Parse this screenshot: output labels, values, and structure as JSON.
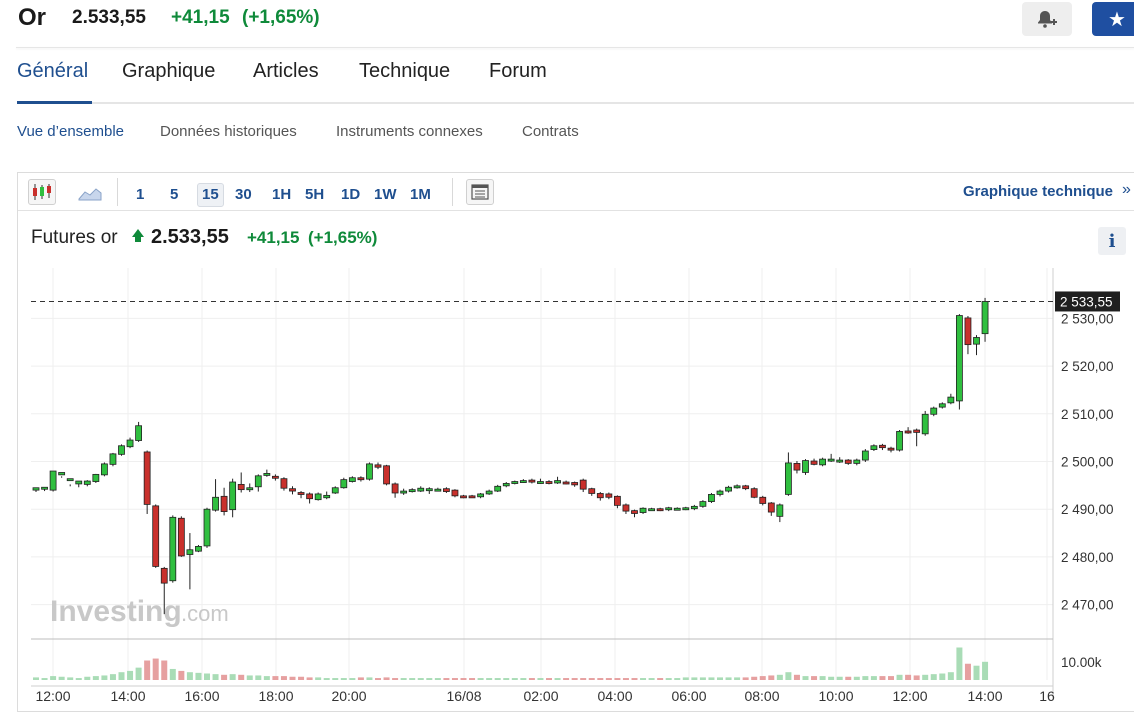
{
  "header": {
    "name": "Or",
    "price": "2.533,55",
    "change": "+41,15",
    "change_pct": "(+1,65%)",
    "star_icon": "★"
  },
  "tabs": [
    {
      "label": "Général"
    },
    {
      "label": "Graphique"
    },
    {
      "label": "Articles"
    },
    {
      "label": "Technique"
    },
    {
      "label": "Forum"
    }
  ],
  "subtabs": [
    {
      "label": "Vue d’ensemble"
    },
    {
      "label": "Données historiques"
    },
    {
      "label": "Instruments connexes"
    },
    {
      "label": "Contrats"
    }
  ],
  "toolbar": {
    "timeframes": [
      "1",
      "5",
      "15",
      "30",
      "1H",
      "5H",
      "1D",
      "1W",
      "1M"
    ],
    "selected_timeframe": "15",
    "tech_link": "Graphique technique",
    "tech_link_arrow": "»",
    "icons": [
      "candlestick-icon",
      "area-chart-icon",
      "layout-icon"
    ]
  },
  "futures": {
    "name": "Futures or",
    "price": "2.533,55",
    "change": "+41,15",
    "change_pct": "(+1,65%)",
    "info_label": "i"
  },
  "watermark": {
    "brand": "Investing",
    "suffix": ".com"
  },
  "colors": {
    "accent": "#1f4f8f",
    "up": "#2fbf3f",
    "down": "#c9302c",
    "positive_text": "#0f8a3a",
    "fav_button": "#1f4fa1"
  },
  "chart_data": {
    "type": "candlestick",
    "price_axis_ticks": [
      "2 530,00",
      "2 520,00",
      "2 510,00",
      "2 500,00",
      "2 490,00",
      "2 480,00",
      "2 470,00"
    ],
    "price_axis_values": [
      2530,
      2520,
      2510,
      2500,
      2490,
      2480,
      2470
    ],
    "last_price_label": "2 533,55",
    "last_price": 2533.55,
    "volume_axis_label": "10.00k",
    "x_tick_labels": [
      "12:00",
      "14:00",
      "16:00",
      "18:00",
      "20:00",
      "16/08",
      "02:00",
      "04:00",
      "06:00",
      "08:00",
      "10:00",
      "12:00",
      "14:00",
      "16"
    ],
    "ylim": [
      2464,
      2537
    ],
    "grid": true,
    "candles": [
      [
        2494,
        2494.5,
        2494,
        2493.6
      ],
      [
        2494.3,
        2494.6,
        2494.3,
        2493.8
      ],
      [
        2494,
        2498,
        2497.3,
        2493.7
      ],
      [
        2497.2,
        2497.7,
        2496.9,
        2496.6
      ],
      [
        2496.3,
        2496.4,
        2495.2,
        2494.8
      ],
      [
        2495.3,
        2495.9,
        2495.4,
        2494.6
      ],
      [
        2495.2,
        2495.9,
        2496.1,
        2494.8
      ],
      [
        2495.8,
        2497.3,
        2497.4,
        2495.5
      ],
      [
        2497.2,
        2499.5,
        2499.8,
        2496.9
      ],
      [
        2499.4,
        2501.6,
        2501.8,
        2499
      ],
      [
        2501.5,
        2503.3,
        2503.6,
        2501.2
      ],
      [
        2503.1,
        2504.5,
        2505,
        2502.8
      ],
      [
        2504.4,
        2507.5,
        2508.3,
        2504.1
      ],
      [
        2502,
        2491,
        2502.3,
        2489
      ],
      [
        2490.7,
        2478,
        2491,
        2477.7
      ],
      [
        2477.6,
        2474.5,
        2477.9,
        2468
      ],
      [
        2475,
        2488.3,
        2488.7,
        2474.6
      ],
      [
        2488.1,
        2480.2,
        2488.5,
        2480
      ],
      [
        2480.5,
        2481.5,
        2485,
        2473.2
      ],
      [
        2481.2,
        2482.2,
        2482.5,
        2481
      ],
      [
        2482.3,
        2490,
        2490.3,
        2481.9
      ],
      [
        2489.8,
        2492.5,
        2496.3,
        2489.5
      ],
      [
        2492.7,
        2489.5,
        2494.5,
        2488.7
      ],
      [
        2489.9,
        2495.7,
        2496.4,
        2488.3
      ],
      [
        2495.2,
        2494.1,
        2497.7,
        2493.5
      ],
      [
        2494.3,
        2494.5,
        2495.4,
        2493.6
      ],
      [
        2494.7,
        2497,
        2497.3,
        2493.7
      ],
      [
        2497.4,
        2497.5,
        2498.3,
        2496.8
      ],
      [
        2496.9,
        2496.6,
        2497.3,
        2496
      ],
      [
        2496.4,
        2494.4,
        2496.7,
        2493.9
      ],
      [
        2494.3,
        2493.8,
        2494.8,
        2493.1
      ],
      [
        2493.5,
        2493.2,
        2493.8,
        2492.3
      ],
      [
        2493.2,
        2492.2,
        2493.5,
        2491.2
      ],
      [
        2492,
        2493.2,
        2493.5,
        2491.8
      ],
      [
        2492.4,
        2492.9,
        2493.7,
        2492.1
      ],
      [
        2493.4,
        2494.5,
        2494.8,
        2493.2
      ],
      [
        2494.5,
        2496.2,
        2496.6,
        2494.3
      ],
      [
        2495.8,
        2496.6,
        2496.9,
        2495.6
      ],
      [
        2496.6,
        2496.3,
        2496.9,
        2495.8
      ],
      [
        2496.3,
        2499.5,
        2499.8,
        2496
      ],
      [
        2499.3,
        2498.8,
        2499.8,
        2498.4
      ],
      [
        2499.1,
        2495.3,
        2499.3,
        2495
      ],
      [
        2495.3,
        2493.4,
        2495.6,
        2492.4
      ],
      [
        2493.4,
        2493.8,
        2494.3,
        2493
      ],
      [
        2493.8,
        2494.1,
        2494.4,
        2493.5
      ],
      [
        2493.8,
        2494.4,
        2494.8,
        2493.6
      ],
      [
        2494.2,
        2494.3,
        2494.6,
        2493.2
      ],
      [
        2494.1,
        2494.2,
        2494.5,
        2493.8
      ],
      [
        2494.3,
        2493.7,
        2494.6,
        2493.4
      ],
      [
        2494,
        2492.8,
        2494.2,
        2492.5
      ],
      [
        2492.8,
        2492.6,
        2493,
        2492.3
      ],
      [
        2492.8,
        2492.7,
        2493,
        2492.5
      ],
      [
        2492.6,
        2493.2,
        2493.4,
        2492.3
      ],
      [
        2493.2,
        2493.8,
        2494.1,
        2493
      ],
      [
        2493.8,
        2494.8,
        2495.1,
        2493.6
      ],
      [
        2494.9,
        2495.4,
        2495.7,
        2494.6
      ],
      [
        2495.4,
        2495.8,
        2496,
        2495.2
      ],
      [
        2495.9,
        2496,
        2496.3,
        2495.5
      ],
      [
        2496.1,
        2495.7,
        2496.4,
        2495.4
      ],
      [
        2495.7,
        2495.8,
        2496.4,
        2495.3
      ],
      [
        2495.8,
        2495.6,
        2496.1,
        2495.2
      ],
      [
        2495.5,
        2496,
        2496.8,
        2495.3
      ],
      [
        2495.7,
        2495.5,
        2496,
        2495.2
      ],
      [
        2495.6,
        2495.1,
        2495.8,
        2494.7
      ],
      [
        2496.1,
        2494.2,
        2496.4,
        2493.6
      ],
      [
        2494.3,
        2493.3,
        2494.5,
        2492.8
      ],
      [
        2493.3,
        2492.4,
        2493.6,
        2491.8
      ],
      [
        2493.2,
        2492.5,
        2493.5,
        2492.1
      ],
      [
        2492.7,
        2490.8,
        2492.9,
        2490.2
      ],
      [
        2490.9,
        2489.6,
        2491.2,
        2489
      ],
      [
        2489.7,
        2489.1,
        2489.9,
        2488.3
      ],
      [
        2489.3,
        2490.2,
        2490.4,
        2489
      ],
      [
        2490.1,
        2490.1,
        2490.3,
        2489.8
      ],
      [
        2490.1,
        2490,
        2490.3,
        2489.6
      ],
      [
        2490,
        2490.3,
        2490.5,
        2489.6
      ],
      [
        2490.1,
        2490.2,
        2490.4,
        2489.9
      ],
      [
        2490.1,
        2490.3,
        2490.5,
        2489.8
      ],
      [
        2490.1,
        2490.6,
        2490.9,
        2489.8
      ],
      [
        2490.6,
        2491.6,
        2491.9,
        2490.3
      ],
      [
        2491.6,
        2493.1,
        2493.4,
        2491.3
      ],
      [
        2493.1,
        2493.8,
        2494.1,
        2492.7
      ],
      [
        2493.8,
        2494.6,
        2494.9,
        2493.5
      ],
      [
        2494.6,
        2494.9,
        2495.2,
        2494.3
      ],
      [
        2494.9,
        2494.3,
        2495.1,
        2494
      ],
      [
        2494.3,
        2492.5,
        2494.6,
        2492.3
      ],
      [
        2492.5,
        2491.2,
        2492.8,
        2490.8
      ],
      [
        2491.3,
        2489.4,
        2491.5,
        2488.6
      ],
      [
        2488.5,
        2490.9,
        2491.2,
        2487.3
      ],
      [
        2493.1,
        2499.7,
        2501.9,
        2492.8
      ],
      [
        2499.6,
        2498.2,
        2500.1,
        2497.5
      ],
      [
        2497.7,
        2500.2,
        2500.5,
        2497.2
      ],
      [
        2500.1,
        2499.4,
        2500.6,
        2499.2
      ],
      [
        2499.3,
        2500.5,
        2500.8,
        2499
      ],
      [
        2500.2,
        2500.5,
        2501.6,
        2499.9
      ],
      [
        2500.2,
        2500.3,
        2500.9,
        2499.7
      ],
      [
        2500.3,
        2499.6,
        2500.5,
        2499.3
      ],
      [
        2499.6,
        2500.3,
        2500.6,
        2499.2
      ],
      [
        2500.3,
        2502.2,
        2502.6,
        2499.9
      ],
      [
        2502.5,
        2503.3,
        2503.6,
        2502.2
      ],
      [
        2503.4,
        2502.9,
        2503.7,
        2502.4
      ],
      [
        2502.8,
        2502.4,
        2503.1,
        2501.9
      ],
      [
        2502.4,
        2506.3,
        2506.6,
        2502.1
      ],
      [
        2506.4,
        2506.1,
        2507.2,
        2505.8
      ],
      [
        2506.6,
        2506.1,
        2506.9,
        2503.2
      ],
      [
        2505.8,
        2509.9,
        2510.6,
        2505.4
      ],
      [
        2509.9,
        2511.2,
        2511.5,
        2509.5
      ],
      [
        2511.4,
        2512.1,
        2512.4,
        2511.1
      ],
      [
        2512.3,
        2513.5,
        2514.2,
        2512
      ],
      [
        2512.7,
        2530.6,
        2530.9,
        2510.9
      ],
      [
        2530.1,
        2524.5,
        2530.5,
        2522.5
      ],
      [
        2524.6,
        2526,
        2526.5,
        2522.3
      ],
      [
        2526.8,
        2533.55,
        2534.3,
        2525.1
      ]
    ],
    "volumes": [
      0.4,
      0.3,
      0.6,
      0.5,
      0.4,
      0.3,
      0.5,
      0.6,
      0.7,
      0.9,
      1.2,
      1.4,
      1.9,
      3.0,
      3.3,
      3.0,
      1.7,
      1.4,
      1.2,
      1.1,
      1.0,
      0.9,
      0.8,
      0.9,
      0.8,
      0.7,
      0.7,
      0.6,
      0.6,
      0.6,
      0.5,
      0.5,
      0.4,
      0.4,
      0.3,
      0.3,
      0.3,
      0.3,
      0.4,
      0.4,
      0.3,
      0.4,
      0.3,
      0.3,
      0.3,
      0.3,
      0.3,
      0.3,
      0.3,
      0.3,
      0.3,
      0.3,
      0.3,
      0.3,
      0.3,
      0.3,
      0.3,
      0.3,
      0.3,
      0.3,
      0.3,
      0.3,
      0.3,
      0.3,
      0.3,
      0.3,
      0.3,
      0.3,
      0.3,
      0.3,
      0.3,
      0.3,
      0.3,
      0.3,
      0.3,
      0.3,
      0.4,
      0.4,
      0.4,
      0.4,
      0.4,
      0.4,
      0.4,
      0.4,
      0.5,
      0.6,
      0.7,
      0.8,
      1.2,
      0.8,
      0.6,
      0.6,
      0.6,
      0.5,
      0.5,
      0.5,
      0.5,
      0.6,
      0.6,
      0.6,
      0.6,
      0.8,
      0.8,
      0.7,
      0.8,
      0.9,
      1.0,
      1.2,
      5.0,
      2.5,
      2.2,
      2.8
    ]
  }
}
